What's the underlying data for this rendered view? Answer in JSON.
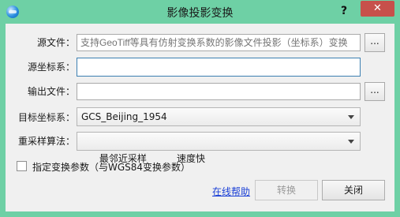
{
  "window": {
    "title": "影像投影变换",
    "help_label": "?",
    "close_label": "✕"
  },
  "form": {
    "source_file": {
      "label": "源文件：",
      "value": "",
      "placeholder": "支持GeoTiff等具有仿射变换系数的影像文件投影（坐标系）变换",
      "browse_label": "..."
    },
    "source_crs": {
      "label": "源坐标系：",
      "value": ""
    },
    "output_file": {
      "label": "输出文件：",
      "value": "",
      "browse_label": "..."
    },
    "target_crs": {
      "label": "目标坐标系：",
      "selected": "GCS_Beijing_1954"
    },
    "resampling": {
      "label": "重采样算法：",
      "selected": "最邻近采样          速度快"
    },
    "specify_params": {
      "label": "指定变换参数（与WGS84变换参数）",
      "checked": false
    }
  },
  "footer": {
    "help_link": "在线帮助",
    "convert_label": "转换",
    "close_label": "关闭"
  },
  "colors": {
    "titlebar": "#6ed0a5",
    "close_button": "#c7504b",
    "link": "#1a3fd6"
  },
  "icons": {
    "app": "app-globe-icon",
    "dropdown": "chevron-down-icon"
  }
}
